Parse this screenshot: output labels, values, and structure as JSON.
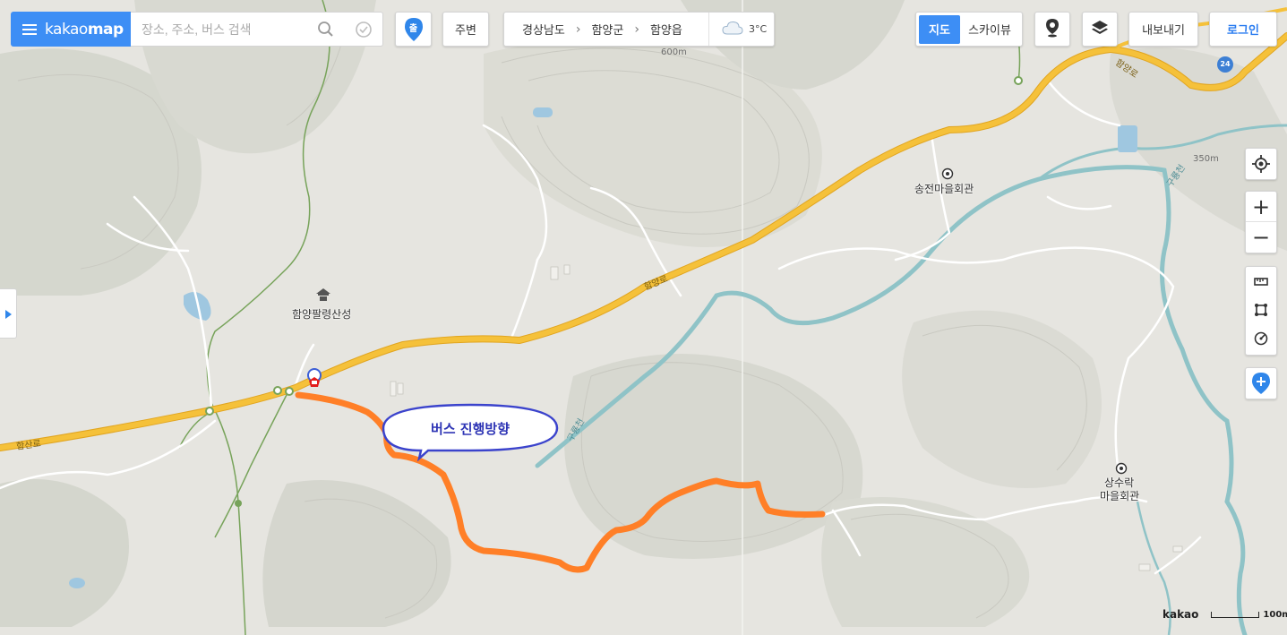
{
  "header": {
    "logo_light": "kakao",
    "logo_bold": "map",
    "search_placeholder": "장소, 주소, 버스 검색",
    "departure_badge": "출",
    "nearby_label": "주변",
    "region": [
      "경상남도",
      "함양군",
      "함양읍"
    ],
    "region_sep": "›",
    "weather_temp": "3°C"
  },
  "map_types": {
    "active": "지도",
    "inactive": "스카이뷰"
  },
  "actions": {
    "export_label": "내보내기",
    "login_label": "로그인"
  },
  "controls": {
    "zoom_in": "+",
    "zoom_out": "−"
  },
  "icons": [
    "menu-icon",
    "search-icon",
    "check-circle-icon",
    "location-pin-icon",
    "cloud-icon",
    "streetview-icon",
    "layers-icon",
    "my-location-icon",
    "ruler-icon",
    "area-icon",
    "radius-icon",
    "add-marker-icon",
    "expand-panel-icon",
    "bus-stop-icon"
  ],
  "places": {
    "fortress": "함양팔령산성",
    "hall_songjeon": "송전마을회관",
    "hall_sangsurak_1": "상수락",
    "hall_sangsurak_2": "마을회관"
  },
  "roads": {
    "hamyang_1": "함양로",
    "hamyang_2": "함양로",
    "hamyang_3": "함양로",
    "hamsan": "함산로"
  },
  "rivers": {
    "gumyong_1": "구룡천",
    "gumyong_2": "구룡천"
  },
  "contours": {
    "c600": "600m",
    "c350": "350m"
  },
  "route_sign": "24",
  "annotation": {
    "text": "버스 진행방향"
  },
  "attribution": {
    "brand": "kakao",
    "scale": "100m"
  },
  "colors": {
    "accent": "#3d8ef5",
    "route_orange": "#ff7f27",
    "annotation_blue": "#3b43cc",
    "road_yellow": "#f5c13a",
    "river": "#8fc3c7",
    "trail_green": "#77a35a",
    "bus_stop_red": "#e21b1b"
  }
}
